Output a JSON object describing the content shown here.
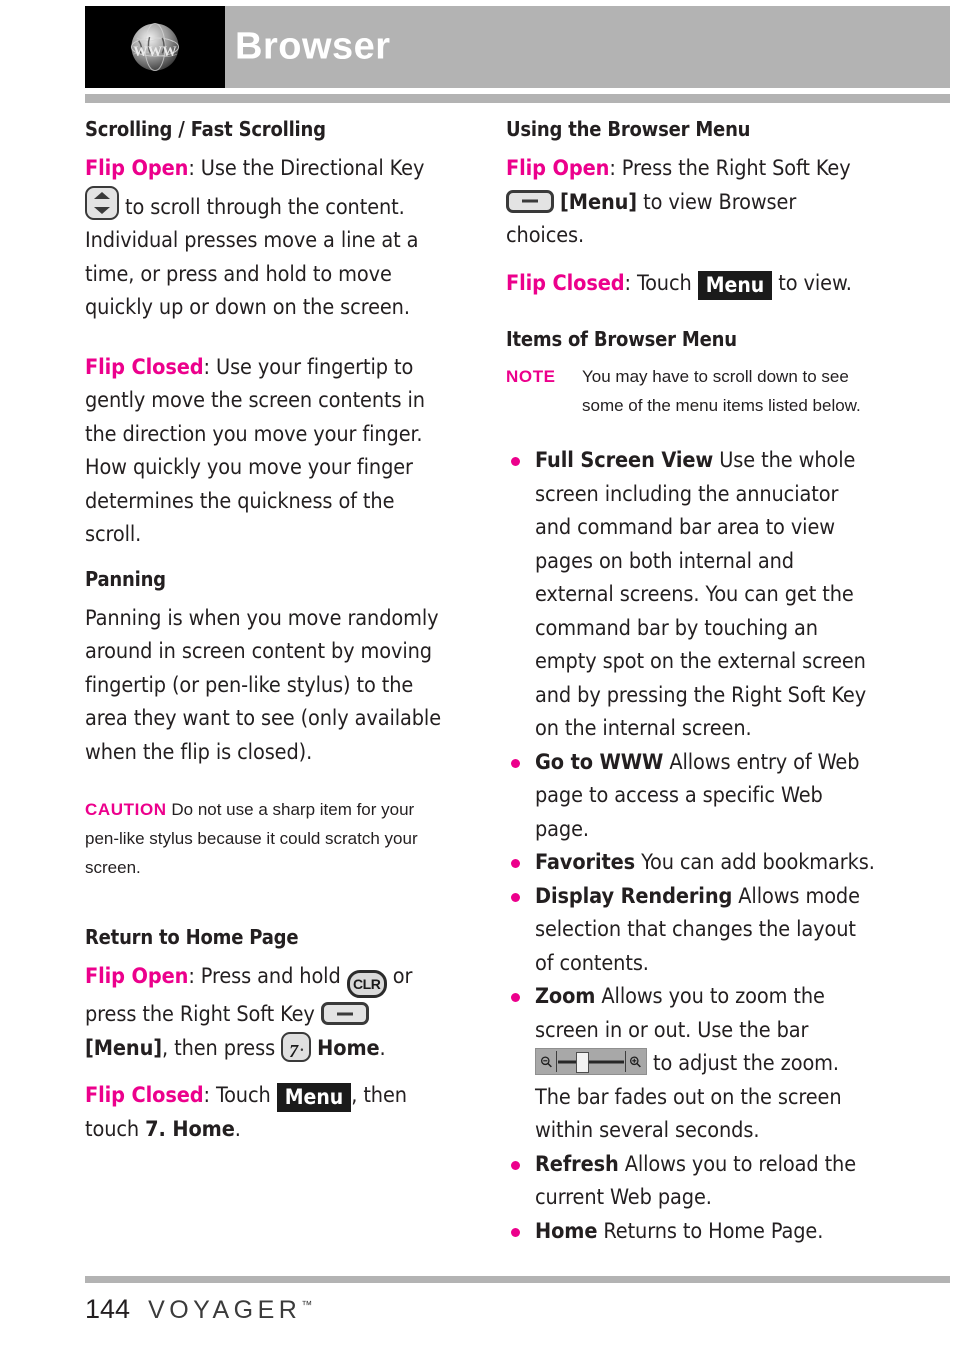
{
  "header": {
    "title": "Browser",
    "icon": "globe-www-icon",
    "icon_label": "WWW",
    "bar_color": "#b3b3b3"
  },
  "colors": {
    "accent_pink": "#ec008c",
    "gray_bar": "#b3b3b3",
    "text": "#231f20"
  },
  "left_column": {
    "section1_heading": "Scrolling / Fast Scrolling",
    "flip_open_label": "Flip Open",
    "flip_open_text_a": ": Use the Directional Key",
    "flip_open_text_b": "to scroll through the content. Individual presses move a line at a time, or press and hold to move quickly up or down on the screen.",
    "flip_closed_label": "Flip Closed",
    "flip_closed_text": ": Use your fingertip to gently move the screen contents in the direction you move your finger. How quickly you move your finger determines the quickness of the scroll.",
    "section2_heading": "Panning",
    "panning_text": "Panning is when you move randomly around in screen content by moving fingertip (or pen-like stylus) to the area they want to see (only available when the flip is closed).",
    "caution_tag": "CAUTION",
    "caution_text": "Do not use a sharp item for your pen-like stylus because it could scratch your screen.",
    "section3_heading": "Return to Home Page",
    "home_flip_open_label": "Flip Open",
    "home_flip_open_a": ": Press and hold",
    "home_flip_open_b": "or press the Right Soft Key",
    "home_flip_open_c": "[Menu]",
    "home_flip_open_d": ", then press",
    "home_flip_open_e": "Home",
    "home_flip_open_f": ".",
    "home_flip_closed_label": "Flip Closed",
    "home_flip_closed_a": ": Touch",
    "home_flip_closed_menu": "Menu",
    "home_flip_closed_b": ", then touch",
    "home_flip_closed_c": "7. Home",
    "home_flip_closed_d": "."
  },
  "right_column": {
    "section1_heading": "Using the Browser Menu",
    "flip_open_label": "Flip Open",
    "flip_open_a": ": Press the Right Soft Key",
    "flip_open_b": "[Menu]",
    "flip_open_c": "to view Browser choices.",
    "flip_closed_label": "Flip Closed",
    "flip_closed_a": ": Touch",
    "flip_closed_menu": "Menu",
    "flip_closed_b": "to view.",
    "section2_heading": "Items of Browser Menu",
    "note_tag": "NOTE",
    "note_text": "You may have to scroll down to see some of the menu items listed below.",
    "menu_items": [
      {
        "name": "Full Screen View",
        "desc": "Use the whole screen including the annuciator and command bar area to view pages on both internal and external screens. You can get the command bar by touching an empty spot on the external screen and by pressing the Right Soft Key on the internal screen."
      },
      {
        "name": "Go to WWW",
        "desc": "Allows entry of Web page to access a specific Web page."
      },
      {
        "name": "Favorites",
        "desc": " You can add bookmarks."
      },
      {
        "name": "Display Rendering",
        "desc": "Allows mode selection that changes the layout of contents."
      },
      {
        "name": "Zoom",
        "desc_a": "Allows you to zoom the screen in or out. Use the bar",
        "desc_b": "to adjust the zoom. The bar fades out on the screen within several seconds."
      },
      {
        "name": "Refresh",
        "desc": "Allows you to reload the current Web page."
      },
      {
        "name": "Home",
        "desc": "Returns to Home Page."
      }
    ]
  },
  "footer": {
    "page_number": "144",
    "brand": "VOYAGER",
    "trademark": "™"
  }
}
